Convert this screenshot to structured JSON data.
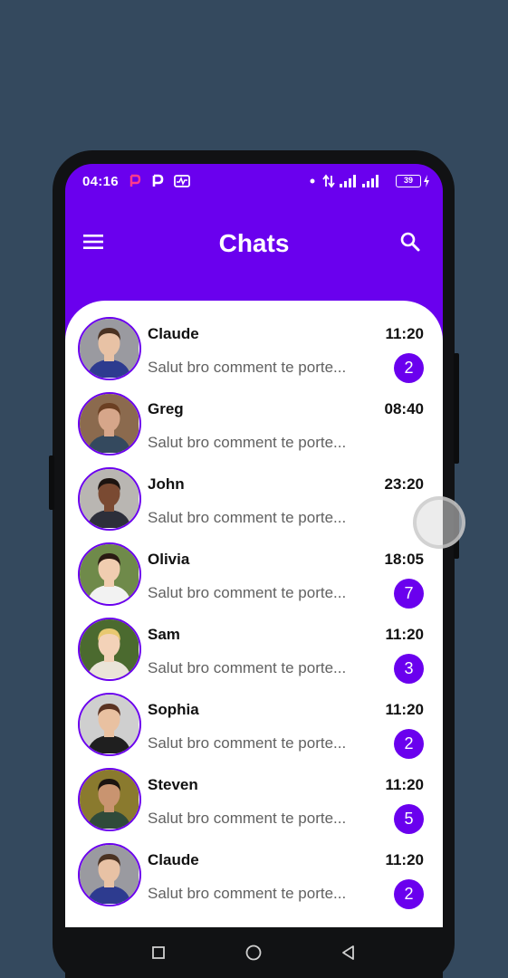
{
  "status_bar": {
    "time": "04:16",
    "battery": "39"
  },
  "header": {
    "title": "Chats"
  },
  "chats": [
    {
      "name": "Claude",
      "message": "Salut bro comment te porte...",
      "time": "11:20",
      "unread": "2",
      "avatar": "avatar-claude"
    },
    {
      "name": "Greg",
      "message": "Salut bro comment te porte...",
      "time": "08:40",
      "unread": "",
      "avatar": "avatar-greg"
    },
    {
      "name": "John",
      "message": "Salut bro comment te porte...",
      "time": "23:20",
      "unread": "",
      "avatar": "avatar-john"
    },
    {
      "name": "Olivia",
      "message": "Salut bro comment te porte...",
      "time": "18:05",
      "unread": "7",
      "avatar": "avatar-olivia"
    },
    {
      "name": "Sam",
      "message": "Salut bro comment te porte...",
      "time": "11:20",
      "unread": "3",
      "avatar": "avatar-sam"
    },
    {
      "name": "Sophia",
      "message": "Salut bro comment te porte...",
      "time": "11:20",
      "unread": "2",
      "avatar": "avatar-sophia"
    },
    {
      "name": "Steven",
      "message": "Salut bro comment te porte...",
      "time": "11:20",
      "unread": "5",
      "avatar": "avatar-steven"
    },
    {
      "name": "Claude",
      "message": "Salut bro comment te porte...",
      "time": "11:20",
      "unread": "2",
      "avatar": "avatar-claude"
    }
  ],
  "icons": {
    "menu": "menu-icon",
    "search": "search-icon",
    "nav_recent": "square-icon",
    "nav_home": "circle-icon",
    "nav_back": "triangle-back-icon"
  },
  "colors": {
    "primary": "#6a00ee",
    "background": "#34495e",
    "sheet": "#ffffff",
    "message_text": "#616161"
  }
}
